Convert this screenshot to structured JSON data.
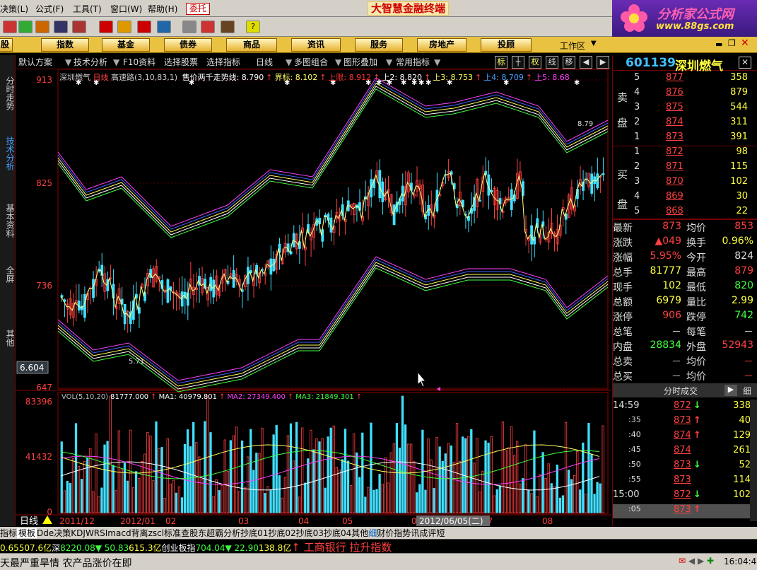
{
  "menu": {
    "items": [
      "决策(L)",
      "公式(F)",
      "工具(T)",
      "窗口(W)",
      "帮助(H)"
    ],
    "entrust": "委托",
    "app_title": "大智慧金融终端"
  },
  "logo": {
    "name": "分析家公式网",
    "url": "www.88gs.com"
  },
  "nav": {
    "tabs": [
      "股",
      "指数",
      "基金",
      "债券",
      "商品",
      "资讯",
      "服务",
      "房地产",
      "投顾"
    ],
    "workspace": "工作区"
  },
  "subbar": {
    "scheme": "默认方案",
    "tech": "技术分析",
    "f10": "F10资料",
    "pick_stock": "选择股票",
    "pick_indicator": "选择指标",
    "period": "日线",
    "multi": "多图组合",
    "overlay": "图形叠加",
    "common": "常用指标",
    "btn_biao": "标",
    "btn_quan": "权",
    "btn_xian": "线",
    "btn_yi": "移"
  },
  "lefttabs": [
    "分时走势",
    "技术分析",
    "基本资料",
    "全屏",
    "其他"
  ],
  "chart": {
    "header_name": "深圳燃气",
    "header_period": "日线",
    "header_ind": "高速路(3,10,83,1)",
    "header_vals": [
      {
        "t": "售价两千走势线: 8.790",
        "c": "#ffffff"
      },
      {
        "t": "↑",
        "c": "#ff4040"
      },
      {
        "t": "界标: 8.102",
        "c": "#ffff60"
      },
      {
        "t": "↑",
        "c": "#ff4040"
      },
      {
        "t": "上限: 8.912",
        "c": "#ff3030"
      },
      {
        "t": "↑",
        "c": "#ff4040"
      },
      {
        "t": "上2: 8.820",
        "c": "#ffffff"
      },
      {
        "t": "↑",
        "c": "#ff4040"
      },
      {
        "t": "上3: 8.753",
        "c": "#ffff60"
      },
      {
        "t": "↑",
        "c": "#ff4040"
      },
      {
        "t": "上4: 8.709",
        "c": "#40a0ff"
      },
      {
        "t": "↑",
        "c": "#ff4040"
      },
      {
        "t": "上5: 8.68",
        "c": "#ff40ff"
      }
    ],
    "yticks": [
      "913",
      "825",
      "736",
      "647"
    ],
    "mark_high": "8.79",
    "mark_low": "5.71",
    "crosshair_val": "6.604",
    "vol_header": [
      {
        "t": "VOL(5,10,20)",
        "c": "#c0c0c0"
      },
      {
        "t": "81777.000",
        "c": "#ffffff"
      },
      {
        "t": "↑",
        "c": "#ff4040"
      },
      {
        "t": "MA1: 40979.801",
        "c": "#ffffff"
      },
      {
        "t": "↑",
        "c": "#ff4040"
      },
      {
        "t": "MA2: 27349.400",
        "c": "#ff40ff"
      },
      {
        "t": "↑",
        "c": "#ff4040"
      },
      {
        "t": "MA3: 21849.301",
        "c": "#40ff40"
      },
      {
        "t": "↑",
        "c": "#ff4040"
      }
    ],
    "vol_yticks": [
      "83396",
      "41432",
      "0"
    ],
    "period_badge": "日线",
    "xticks": [
      "2011/12",
      "2012/01",
      "02",
      "03",
      "04",
      "05",
      "06",
      "07",
      "08"
    ],
    "date_tip": "2012/06/05(二)"
  },
  "quote": {
    "code": "601139",
    "name": "深圳燃气",
    "sell_label": [
      "卖",
      "盘"
    ],
    "buy_label": [
      "买",
      "盘"
    ],
    "sell": [
      [
        "5",
        "877",
        "358"
      ],
      [
        "4",
        "876",
        "879"
      ],
      [
        "3",
        "875",
        "544"
      ],
      [
        "2",
        "874",
        "311"
      ],
      [
        "1",
        "873",
        "391"
      ]
    ],
    "buy": [
      [
        "1",
        "872",
        "98"
      ],
      [
        "2",
        "871",
        "115"
      ],
      [
        "3",
        "870",
        "102"
      ],
      [
        "4",
        "869",
        "30"
      ],
      [
        "5",
        "868",
        "22"
      ]
    ],
    "stats": [
      [
        "最新",
        "873",
        "均价",
        "853"
      ],
      [
        "涨跌",
        "▲049",
        "换手",
        "0.96%"
      ],
      [
        "涨幅",
        "5.95%",
        "今开",
        "824"
      ],
      [
        "总手",
        "81777",
        "最高",
        "879"
      ],
      [
        "现手",
        "102",
        "最低",
        "820"
      ],
      [
        "总额",
        "6979",
        "量比",
        "2.99"
      ],
      [
        "涨停",
        "906",
        "跌停",
        "742"
      ],
      [
        "总笔",
        "－",
        "每笔",
        "－"
      ],
      [
        "内盘",
        "28834",
        "外盘",
        "52943"
      ],
      [
        "总卖",
        "－",
        "均价",
        "－"
      ],
      [
        "总买",
        "－",
        "均价",
        "－"
      ]
    ],
    "ticks_title": "分时成交",
    "ticks_btn": "细",
    "ticks": [
      [
        "14:59",
        "872",
        "↓",
        "338"
      ],
      [
        ":35",
        "873",
        "↑",
        "40"
      ],
      [
        ":40",
        "874",
        "↑",
        "129"
      ],
      [
        ":45",
        "874",
        "",
        "261"
      ],
      [
        ":50",
        "873",
        "↓",
        "52"
      ],
      [
        ":55",
        "873",
        "",
        "114"
      ],
      [
        "15:00",
        "872",
        "↓",
        "102"
      ],
      [
        ":05",
        "873",
        "↑",
        ""
      ]
    ]
  },
  "bottomtabs": [
    "指标",
    "模板",
    "Dde决策",
    "KDJ",
    "WRSI",
    "macd背离",
    "zscl",
    "标准",
    "查股东",
    "超霸分析",
    "抄底01",
    "抄底02",
    "抄底03",
    "抄底04",
    "其他"
  ],
  "righttabs": [
    "细",
    "财",
    "价",
    "指",
    "势",
    "讯",
    "成",
    "评",
    "短"
  ],
  "ticker": [
    {
      "t": "0.65",
      "c": "#ffff40"
    },
    {
      "t": "507.6亿",
      "c": "#ffff40"
    },
    {
      "t": "深",
      "c": "#ffffff"
    },
    {
      "t": "8220.08",
      "c": "#40ff40"
    },
    {
      "t": "▼ 50.83",
      "c": "#40ff40"
    },
    {
      "t": "615.3亿",
      "c": "#ffff40"
    },
    {
      "t": "创业板指",
      "c": "#ffffff"
    },
    {
      "t": "704.04",
      "c": "#40ff40"
    },
    {
      "t": "▼ 22.90",
      "c": "#40ff40"
    },
    {
      "t": "138.8亿",
      "c": "#ffff40"
    },
    {
      "t": "↑ 工商银行 拉升指数",
      "c": "#ff4040"
    }
  ],
  "status": {
    "news": "天最严重旱情 农产品涨价在即",
    "time": "16:04:45"
  }
}
